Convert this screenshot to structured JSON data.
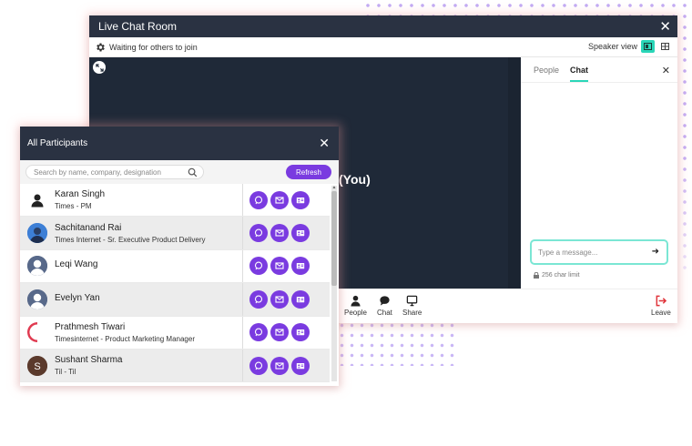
{
  "room": {
    "title": "Live Chat Room",
    "status": "Waiting for others to join",
    "view_label": "Speaker view",
    "you_label": "(You)",
    "tabs": [
      {
        "label": "People"
      },
      {
        "label": "Chat"
      }
    ],
    "active_tab": "Chat",
    "message_placeholder": "Type a message...",
    "char_limit": "256 char limit",
    "toolbar": {
      "people": "People",
      "chat": "Chat",
      "share": "Share",
      "leave": "Leave"
    }
  },
  "participants": {
    "title": "All Participants",
    "search_placeholder": "Search by name, company, designation",
    "refresh_label": "Refresh",
    "list": [
      {
        "name": "Karan Singh",
        "designation": "Times - PM"
      },
      {
        "name": "Sachitanand Rai",
        "designation": "Times Internet - Sr. Executive Product Delivery"
      },
      {
        "name": "Leqi Wang",
        "designation": ""
      },
      {
        "name": "Evelyn Yan",
        "designation": ""
      },
      {
        "name": "Prathmesh Tiwari",
        "designation": "Timesinternet - Product Marketing Manager"
      },
      {
        "name": "Sushant Sharma",
        "designation": "Til - Til"
      }
    ]
  },
  "colors": {
    "accent": "#7a3be0",
    "teal": "#2ad6b8",
    "dark": "#2a3242",
    "leave": "#e0353b"
  }
}
